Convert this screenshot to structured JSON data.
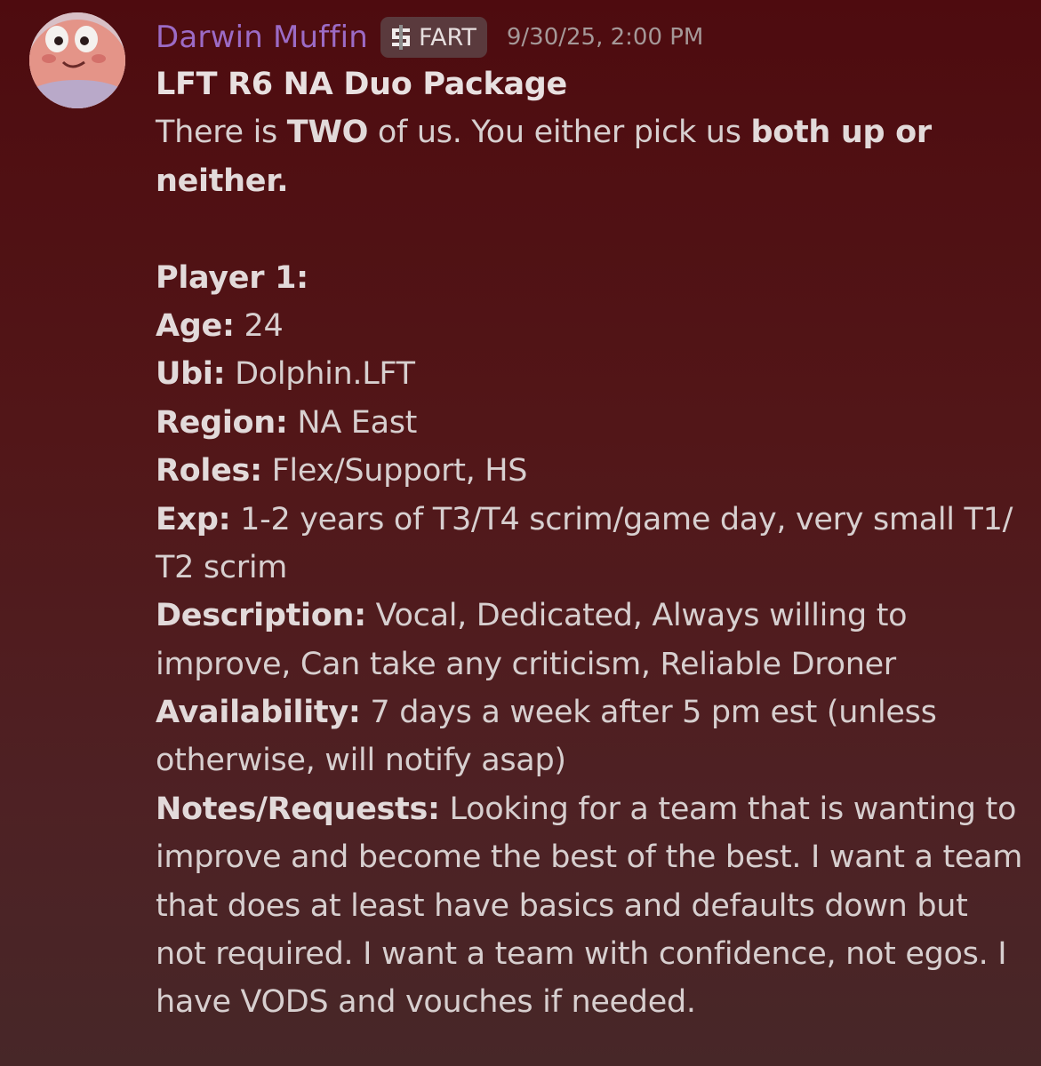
{
  "message": {
    "author": "Darwin Muffin",
    "tag_label": "FART",
    "timestamp": "9/30/25, 2:00 PM",
    "title": "LFT R6 NA Duo Package",
    "intro": {
      "p1": "There is ",
      "b1": "TWO",
      "p2": " of us. You either pick us ",
      "b2": "both up or",
      "b3": "neither."
    },
    "player_heading": "Player 1:",
    "age": {
      "label": "Age:",
      "value": " 24"
    },
    "ubi": {
      "label": "Ubi:",
      "value": " Dolphin.LFT"
    },
    "region": {
      "label": "Region:",
      "value": " NA East"
    },
    "roles": {
      "label": "Roles:",
      "value": " Flex/Support, HS"
    },
    "exp": {
      "label": "Exp:",
      "line1": " 1-2 years of T3/T4 scrim/game day, very small T1/",
      "line2": "T2 scrim"
    },
    "description": {
      "label": "Description:",
      "line1": " Vocal, Dedicated, Always willing to",
      "line2": "improve, Can take any criticism, Reliable Droner"
    },
    "availability": {
      "label": "Availability:",
      "line1": " 7 days a week after 5 pm est (unless",
      "line2": "otherwise, will notify asap)"
    },
    "notes": {
      "label": "Notes/Requests:",
      "line1": " Looking for a team that is wanting to",
      "line2": "improve and become the best of the best. I want a team",
      "line3": "that does at least have basics and defaults down but",
      "line4": "not required. I want a team with confidence, not egos. I",
      "line5": "have VODS and vouches if needed."
    }
  },
  "colors": {
    "username": "#9c6bc5",
    "background_top": "#4e0b0f",
    "background_bottom": "#472728",
    "text": "#d7cfcf"
  },
  "icons": {
    "avatar": "cartoon-face-avatar",
    "tag": "pixel-dollar-icon"
  }
}
